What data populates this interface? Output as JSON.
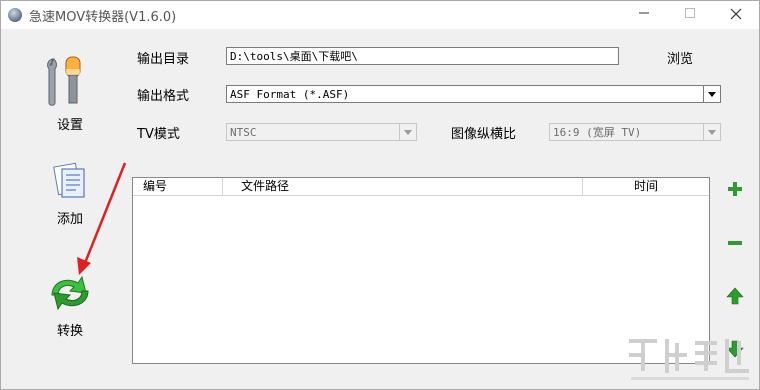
{
  "window": {
    "title": "急速MOV转换器(V1.6.0)"
  },
  "sidebar": {
    "settings_label": "设置",
    "add_label": "添加",
    "convert_label": "转换"
  },
  "form": {
    "output_dir_label": "输出目录",
    "output_dir_value": "D:\\tools\\桌面\\下载吧\\",
    "browse_label": "浏览",
    "format_label": "输出格式",
    "format_value": "ASF Format (*.ASF)",
    "tv_label": "TV模式",
    "tv_value": "NTSC",
    "aspect_label": "图像纵横比",
    "aspect_value": "16:9  (宽屏 TV)"
  },
  "table": {
    "headers": [
      "编号",
      "文件路径",
      "时间"
    ],
    "rows": []
  },
  "colors": {
    "green_accent": "#2e9b2e",
    "annotation_red": "#e02020"
  }
}
